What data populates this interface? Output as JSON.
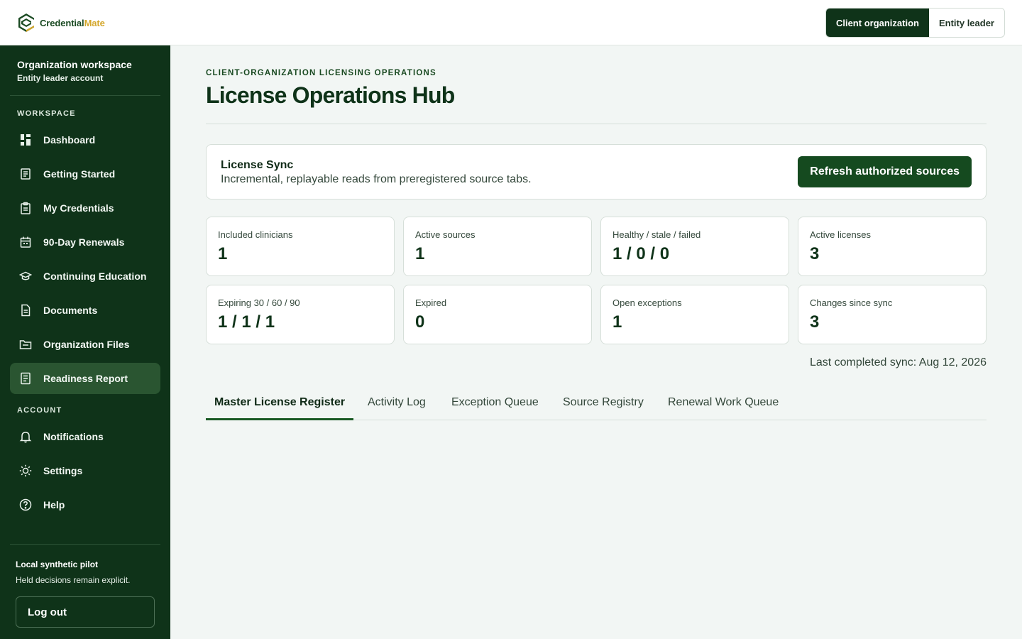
{
  "brand": {
    "name_part1": "Credential",
    "name_part2": "Mate",
    "accent": "#d4a72c"
  },
  "role_toggle": {
    "options": [
      "Client organization",
      "Entity leader"
    ],
    "active": "Client organization"
  },
  "sidebar": {
    "workspace_title": "Organization workspace",
    "workspace_subtitle": "Entity leader account",
    "workspace_section": "WORKSPACE",
    "items": [
      {
        "label": "Dashboard",
        "icon": "dashboard-icon"
      },
      {
        "label": "Getting Started",
        "icon": "checklist-icon"
      },
      {
        "label": "My Credentials",
        "icon": "clipboard-icon"
      },
      {
        "label": "90-Day Renewals",
        "icon": "calendar-icon"
      },
      {
        "label": "Continuing Education",
        "icon": "graduation-cap-icon"
      },
      {
        "label": "Documents",
        "icon": "document-icon"
      },
      {
        "label": "Organization Files",
        "icon": "folder-icon"
      },
      {
        "label": "Readiness Report",
        "icon": "report-icon",
        "active": true
      }
    ],
    "account_section": "ACCOUNT",
    "account_items": [
      {
        "label": "Notifications",
        "icon": "bell-icon"
      },
      {
        "label": "Settings",
        "icon": "gear-icon"
      },
      {
        "label": "Help",
        "icon": "help-icon"
      }
    ],
    "pilot_title": "Local synthetic pilot",
    "pilot_text": "Held decisions remain explicit.",
    "logout_label": "Log out"
  },
  "main": {
    "eyebrow": "CLIENT-ORGANIZATION LICENSING OPERATIONS",
    "title": "License Operations Hub",
    "sync": {
      "title": "License Sync",
      "description": "Incremental, replayable reads from preregistered source tabs.",
      "button": "Refresh authorized sources"
    },
    "stats": [
      {
        "label": "Included clinicians",
        "value": "1"
      },
      {
        "label": "Active sources",
        "value": "1"
      },
      {
        "label": "Healthy / stale / failed",
        "value": "1 / 0 / 0"
      },
      {
        "label": "Active licenses",
        "value": "3"
      },
      {
        "label": "Expiring 30 / 60 / 90",
        "value": "1 / 1 / 1"
      },
      {
        "label": "Expired",
        "value": "0"
      },
      {
        "label": "Open exceptions",
        "value": "1"
      },
      {
        "label": "Changes since sync",
        "value": "3"
      }
    ],
    "last_sync": "Last completed sync: Aug 12, 2026",
    "tabs": [
      {
        "label": "Master License Register",
        "active": true
      },
      {
        "label": "Activity Log"
      },
      {
        "label": "Exception Queue"
      },
      {
        "label": "Source Registry"
      },
      {
        "label": "Renewal Work Queue"
      }
    ]
  },
  "colors": {
    "sidebar_bg": "#0f3319",
    "primary": "#154a1f",
    "active_nav": "#2a5531",
    "page_bg": "#f2f6f4"
  }
}
